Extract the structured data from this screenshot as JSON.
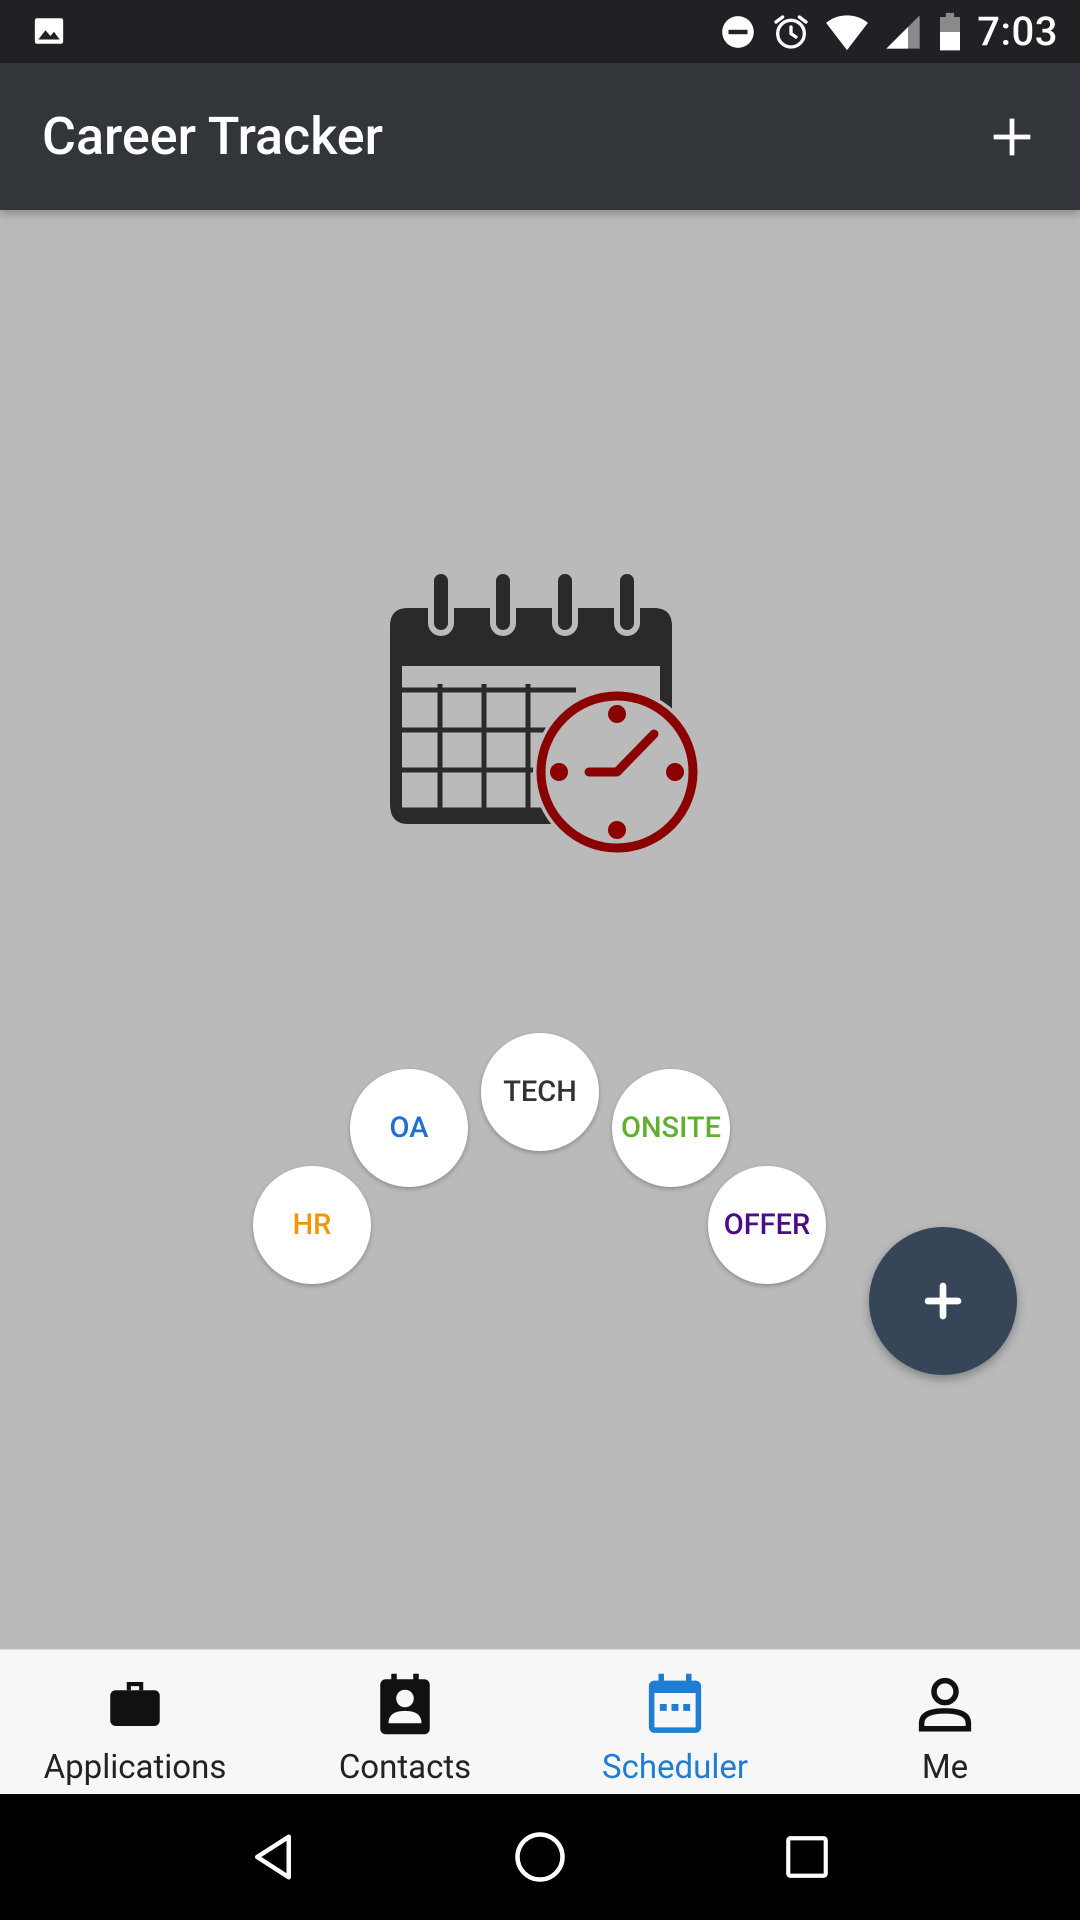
{
  "status_bar": {
    "time": "7:03",
    "icons": [
      "image-icon",
      "do-not-disturb-icon",
      "alarm-icon",
      "wifi-icon",
      "cell-signal-icon",
      "battery-icon"
    ]
  },
  "app_bar": {
    "title": "Career Tracker",
    "action_icon": "plus-icon"
  },
  "content": {
    "hero_icon": "calendar-clock-icon",
    "stage_buttons": [
      {
        "label": "HR",
        "color": "#f59600"
      },
      {
        "label": "OA",
        "color": "#1e6fd6"
      },
      {
        "label": "TECH",
        "color": "#333333"
      },
      {
        "label": "ONSITE",
        "color": "#5fb030"
      },
      {
        "label": "OFFER",
        "color": "#4b0c86"
      }
    ],
    "fab_icon": "plus-icon"
  },
  "bottom_nav": {
    "items": [
      {
        "label": "Applications",
        "icon": "briefcase-icon",
        "active": false
      },
      {
        "label": "Contacts",
        "icon": "contact-card-icon",
        "active": false
      },
      {
        "label": "Scheduler",
        "icon": "calendar-icon",
        "active": true
      },
      {
        "label": "Me",
        "icon": "person-icon",
        "active": false
      }
    ],
    "active_color": "#1e7dd4"
  },
  "system_nav": {
    "buttons": [
      "back-icon",
      "home-icon",
      "recents-icon"
    ]
  },
  "colors": {
    "app_bar": "#32363a",
    "status_bar": "#1f2124",
    "background": "#bababa",
    "fab": "#374558",
    "clock_accent": "#8b0000"
  }
}
